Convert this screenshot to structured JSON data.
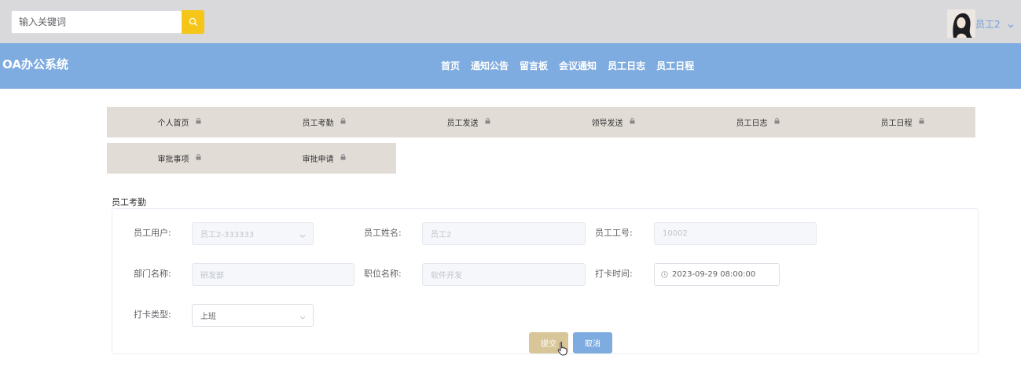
{
  "header": {
    "search": {
      "placeholder": "输入关键词"
    },
    "user": {
      "name": "员工2"
    }
  },
  "navbar": {
    "brand": "OA办公系统",
    "items": [
      "首页",
      "通知公告",
      "留言板",
      "会议通知",
      "员工日志",
      "员工日程"
    ]
  },
  "submenu": {
    "items": [
      "个人首页",
      "员工考勤",
      "员工发送",
      "领导发送",
      "员工日志",
      "员工日程",
      "审批事项",
      "审批申请"
    ]
  },
  "form": {
    "section_title": "员工考勤",
    "fields": {
      "user": {
        "label": "员工用户:",
        "value": "员工2-333333"
      },
      "name": {
        "label": "员工姓名:",
        "value": "员工2"
      },
      "number": {
        "label": "员工工号:",
        "value": "10002"
      },
      "department": {
        "label": "部门名称:",
        "value": "研发部"
      },
      "position": {
        "label": "职位名称:",
        "value": "软件开发"
      },
      "clock_time": {
        "label": "打卡时间:",
        "value": "2023-09-29 08:00:00"
      },
      "clock_type": {
        "label": "打卡类型:",
        "value": "上班"
      }
    },
    "buttons": {
      "submit": "提交",
      "cancel": "取消"
    }
  },
  "colors": {
    "topbar": "#d9d9dc",
    "navbar": "#7eabe0",
    "search_button": "#f5c518",
    "submenu": "#e2dcd7",
    "submit": "#d8c598",
    "cancel": "#7eabe0"
  }
}
